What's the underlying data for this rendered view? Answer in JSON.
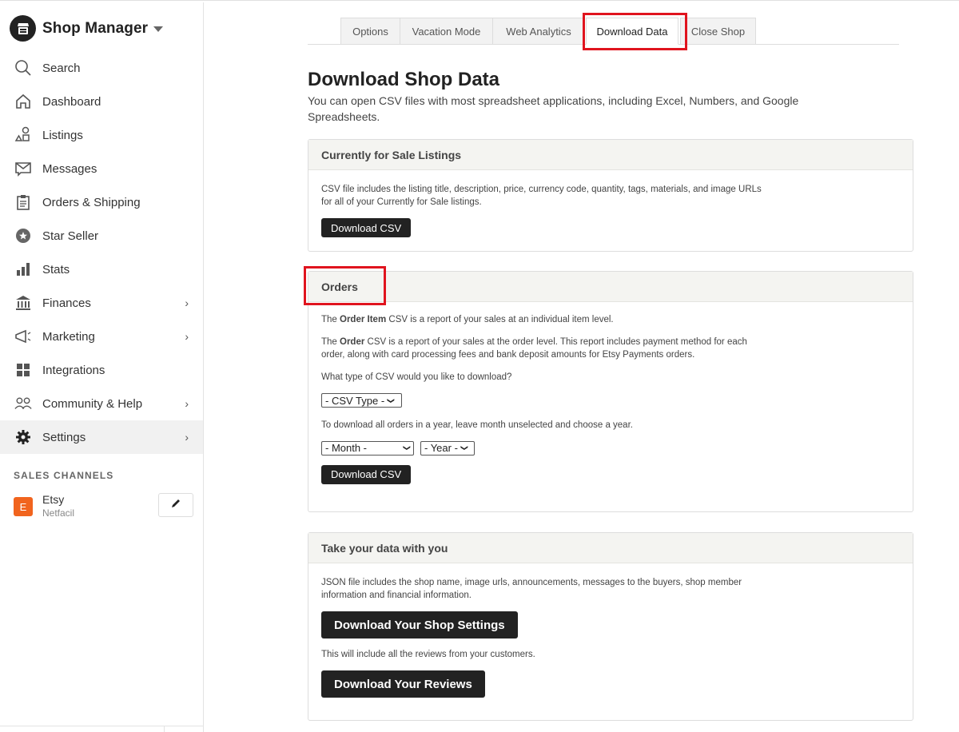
{
  "sidebar": {
    "brand": "Shop Manager",
    "items": [
      {
        "label": "Search",
        "icon": "search-icon"
      },
      {
        "label": "Dashboard",
        "icon": "home-icon"
      },
      {
        "label": "Listings",
        "icon": "shapes-icon"
      },
      {
        "label": "Messages",
        "icon": "envelope-icon"
      },
      {
        "label": "Orders & Shipping",
        "icon": "clipboard-icon"
      },
      {
        "label": "Star Seller",
        "icon": "star-badge-icon"
      },
      {
        "label": "Stats",
        "icon": "bar-chart-icon"
      },
      {
        "label": "Finances",
        "icon": "bank-icon",
        "chevron": "›"
      },
      {
        "label": "Marketing",
        "icon": "megaphone-icon",
        "chevron": "›"
      },
      {
        "label": "Integrations",
        "icon": "grid-icon"
      },
      {
        "label": "Community & Help",
        "icon": "people-icon",
        "chevron": "›"
      },
      {
        "label": "Settings",
        "icon": "gear-icon",
        "chevron": "›",
        "active": true
      }
    ],
    "sales_channels_title": "SALES CHANNELS",
    "channel": {
      "badge": "E",
      "name": "Etsy",
      "shop": "Netfacil",
      "badge_color": "#f1641e"
    }
  },
  "tabs": [
    {
      "label": "Options"
    },
    {
      "label": "Vacation Mode"
    },
    {
      "label": "Web Analytics"
    },
    {
      "label": "Download Data",
      "active": true
    },
    {
      "label": "Close Shop"
    }
  ],
  "main": {
    "title": "Download Shop Data",
    "subtitle": "You can open CSV files with most spreadsheet applications, including Excel, Numbers, and Google Spreadsheets.",
    "listings_panel": {
      "title": "Currently for Sale Listings",
      "description": "CSV file includes the listing title, description, price, currency code, quantity, tags, materials, and image URLs for all of your Currently for Sale listings.",
      "button": "Download CSV"
    },
    "orders_panel": {
      "title": "Orders",
      "p1_pre": "The ",
      "p1_bold": "Order Item",
      "p1_post": " CSV is a report of your sales at an individual item level.",
      "p2_pre": "The ",
      "p2_bold": "Order",
      "p2_post": " CSV is a report of your sales at the order level. This report includes payment method for each order, along with card processing fees and bank deposit amounts for Etsy Payments orders.",
      "question": "What type of CSV would you like to download?",
      "csv_type_select": "- CSV Type -",
      "year_hint": "To download all orders in a year, leave month unselected and choose a year.",
      "month_select": "- Month -",
      "year_select": "- Year -",
      "button": "Download CSV"
    },
    "takeout_panel": {
      "title": "Take your data with you",
      "description": "JSON file includes the shop name, image urls, announcements, messages to the buyers, shop member information and financial information.",
      "settings_button": "Download Your Shop Settings",
      "reviews_hint": "This will include all the reviews from your customers.",
      "reviews_button": "Download Your Reviews"
    }
  },
  "highlight_color": "#e0141e"
}
